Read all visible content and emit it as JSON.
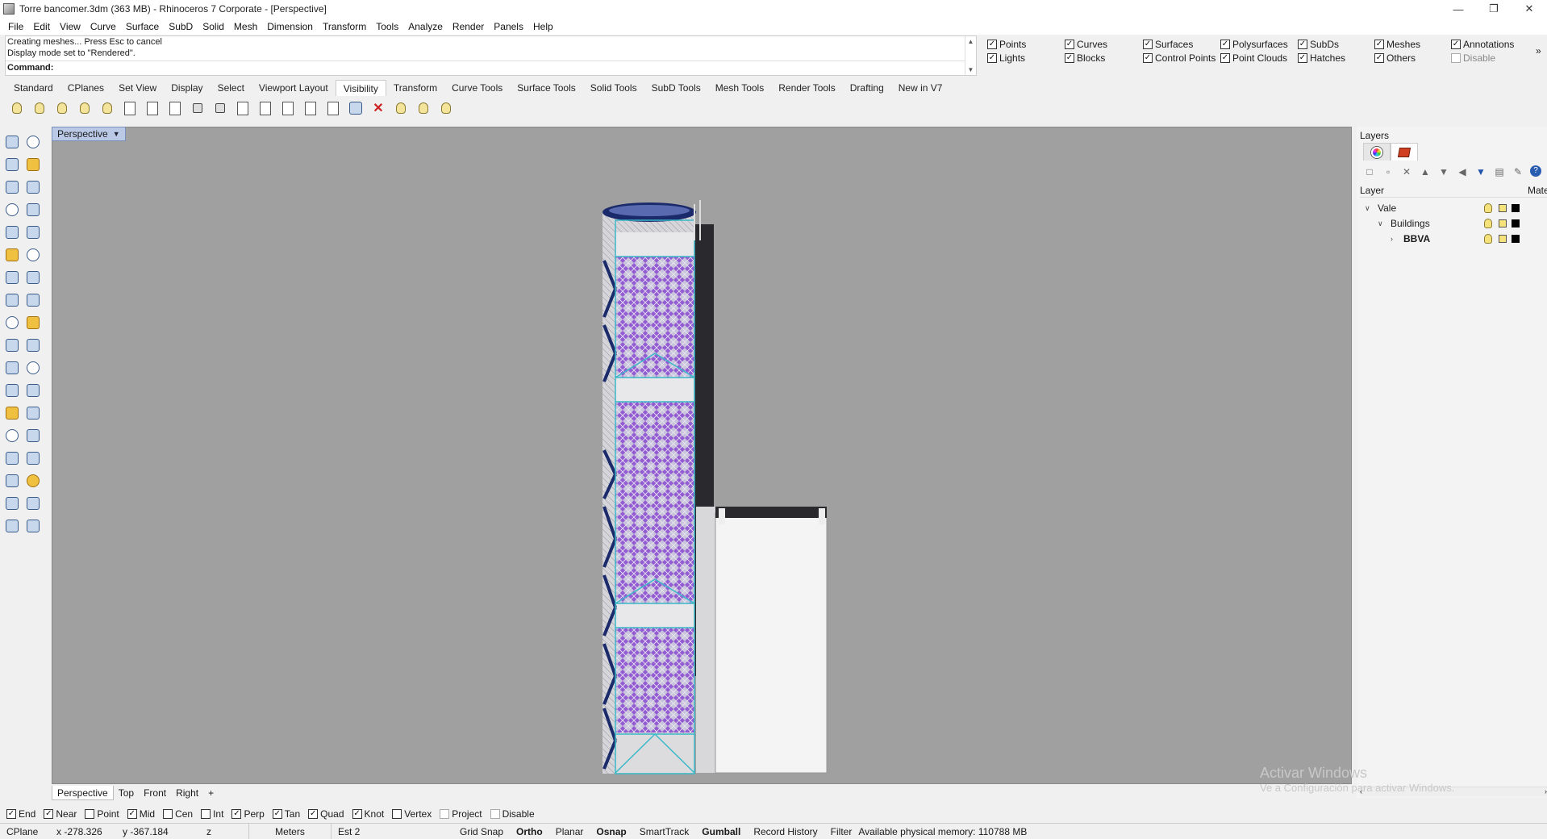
{
  "window": {
    "title": "Torre bancomer.3dm (363 MB) - Rhinoceros 7 Corporate - [Perspective]",
    "minimize": "—",
    "restore": "❐",
    "close": "✕"
  },
  "menu": [
    "File",
    "Edit",
    "View",
    "Curve",
    "Surface",
    "SubD",
    "Solid",
    "Mesh",
    "Dimension",
    "Transform",
    "Tools",
    "Analyze",
    "Render",
    "Panels",
    "Help"
  ],
  "command": {
    "history": [
      "Creating meshes... Press Esc to cancel",
      "Display mode set to \"Rendered\"."
    ],
    "prompt": "Command:"
  },
  "filters": [
    {
      "label": "Points",
      "checked": true
    },
    {
      "label": "Curves",
      "checked": true
    },
    {
      "label": "Surfaces",
      "checked": true
    },
    {
      "label": "Polysurfaces",
      "checked": true
    },
    {
      "label": "SubDs",
      "checked": true
    },
    {
      "label": "Meshes",
      "checked": true
    },
    {
      "label": "Annotations",
      "checked": true
    },
    {
      "label": "Lights",
      "checked": true
    },
    {
      "label": "Blocks",
      "checked": true
    },
    {
      "label": "Control Points",
      "checked": true
    },
    {
      "label": "Point Clouds",
      "checked": true
    },
    {
      "label": "Hatches",
      "checked": true
    },
    {
      "label": "Others",
      "checked": true
    },
    {
      "label": "Disable",
      "checked": false
    }
  ],
  "toolbar_tabs": [
    "Standard",
    "CPlanes",
    "Set View",
    "Display",
    "Select",
    "Viewport Layout",
    "Visibility",
    "Transform",
    "Curve Tools",
    "Surface Tools",
    "Solid Tools",
    "SubD Tools",
    "Mesh Tools",
    "Render Tools",
    "Drafting",
    "New in V7"
  ],
  "active_tab": "Visibility",
  "viewport": {
    "label": "Perspective",
    "tabs": [
      "Perspective",
      "Top",
      "Front",
      "Right"
    ],
    "add_tab": "+"
  },
  "watermark": {
    "line1": "Activar Windows",
    "line2": "Ve a Configuración para activar Windows."
  },
  "layers_panel": {
    "title": "Layers",
    "column_layer": "Layer",
    "column_material": "Mate",
    "rows": [
      {
        "name": "Vale",
        "indent": 0,
        "expander": "∨",
        "bold": false
      },
      {
        "name": "Buildings",
        "indent": 1,
        "expander": "∨",
        "bold": false
      },
      {
        "name": "BBVA",
        "indent": 2,
        "expander": "›",
        "bold": true
      }
    ]
  },
  "osnaps": [
    {
      "label": "End",
      "checked": true
    },
    {
      "label": "Near",
      "checked": true
    },
    {
      "label": "Point",
      "checked": false
    },
    {
      "label": "Mid",
      "checked": true
    },
    {
      "label": "Cen",
      "checked": false
    },
    {
      "label": "Int",
      "checked": false
    },
    {
      "label": "Perp",
      "checked": true
    },
    {
      "label": "Tan",
      "checked": true
    },
    {
      "label": "Quad",
      "checked": true
    },
    {
      "label": "Knot",
      "checked": true
    },
    {
      "label": "Vertex",
      "checked": false
    },
    {
      "label": "Project",
      "checked": false
    },
    {
      "label": "Disable",
      "checked": false
    }
  ],
  "status": {
    "cplane": "CPlane",
    "x": "x -278.326",
    "y": "y -367.184",
    "z": "z",
    "units": "Meters",
    "layer": "Est 2",
    "grid_snap": "Grid Snap",
    "ortho": "Ortho",
    "planar": "Planar",
    "osnap": "Osnap",
    "smarttrack": "SmartTrack",
    "gumball": "Gumball",
    "record_history": "Record History",
    "filter": "Filter",
    "memory": "Available physical memory: 110788 MB"
  },
  "colors": {
    "viewport_bg": "#a0a0a0",
    "facade_purple": "#8a4ad0",
    "structure_cyan": "#3ab8c8",
    "frame_navy": "#1a2a6a"
  }
}
